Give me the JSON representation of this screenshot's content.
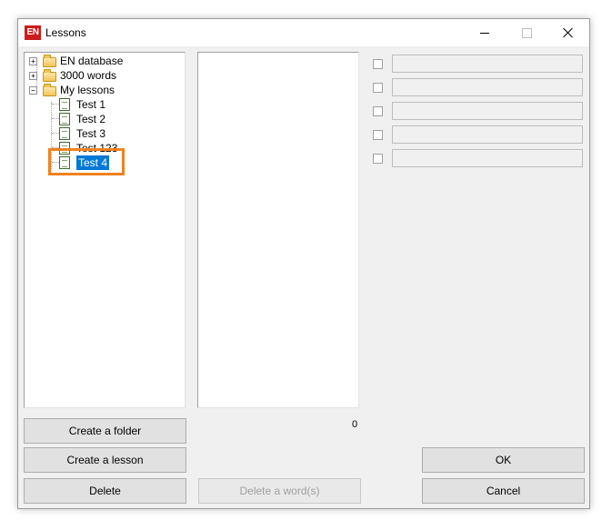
{
  "window": {
    "title": "Lessons",
    "app_icon_text": "EN",
    "accent_color": "#0078d7",
    "highlight_color": "#f0821e"
  },
  "tree": {
    "items": [
      {
        "label": "EN database",
        "type": "folder",
        "expander": "+"
      },
      {
        "label": "3000 words",
        "type": "folder",
        "expander": "+"
      },
      {
        "label": "My lessons",
        "type": "folder",
        "expander": "−"
      },
      {
        "label": "Test 1",
        "type": "lesson"
      },
      {
        "label": "Test 2",
        "type": "lesson"
      },
      {
        "label": "Test 3",
        "type": "lesson"
      },
      {
        "label": "Test 123",
        "type": "lesson"
      },
      {
        "label": "Test 4",
        "type": "lesson",
        "selected": true
      }
    ]
  },
  "words": {
    "count": "0"
  },
  "buttons": {
    "create_folder": "Create a folder",
    "create_lesson": "Create a lesson",
    "delete": "Delete",
    "delete_word": "Delete a word(s)",
    "ok": "OK",
    "cancel": "Cancel"
  }
}
